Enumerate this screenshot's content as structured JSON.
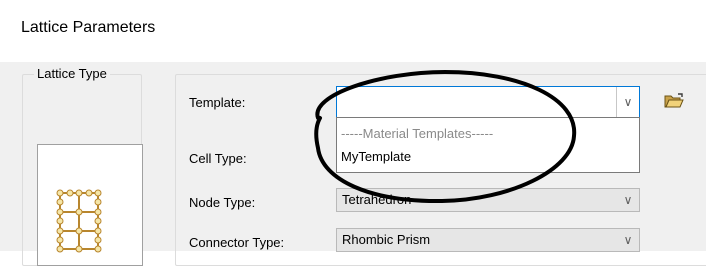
{
  "window": {
    "title": "Lattice Parameters"
  },
  "lattice_type": {
    "legend": "Lattice Type"
  },
  "form": {
    "template_label": "Template:",
    "template_value": "",
    "cell_type_label": "Cell Type:",
    "node_type_label": "Node Type:",
    "node_type_value": "Tetrahedron",
    "connector_type_label": "Connector Type:",
    "connector_type_value": "Rhombic Prism"
  },
  "dropdown": {
    "items": [
      "-----Material Templates-----",
      "MyTemplate"
    ]
  },
  "icons": {
    "chevron": "chevron-down-icon",
    "folder": "folder-open-icon"
  },
  "colors": {
    "focus_border": "#0078d7",
    "dialog_bg": "#f0f0f0",
    "header_disabled_text": "#8a8a8a",
    "annotation": "#000000"
  }
}
